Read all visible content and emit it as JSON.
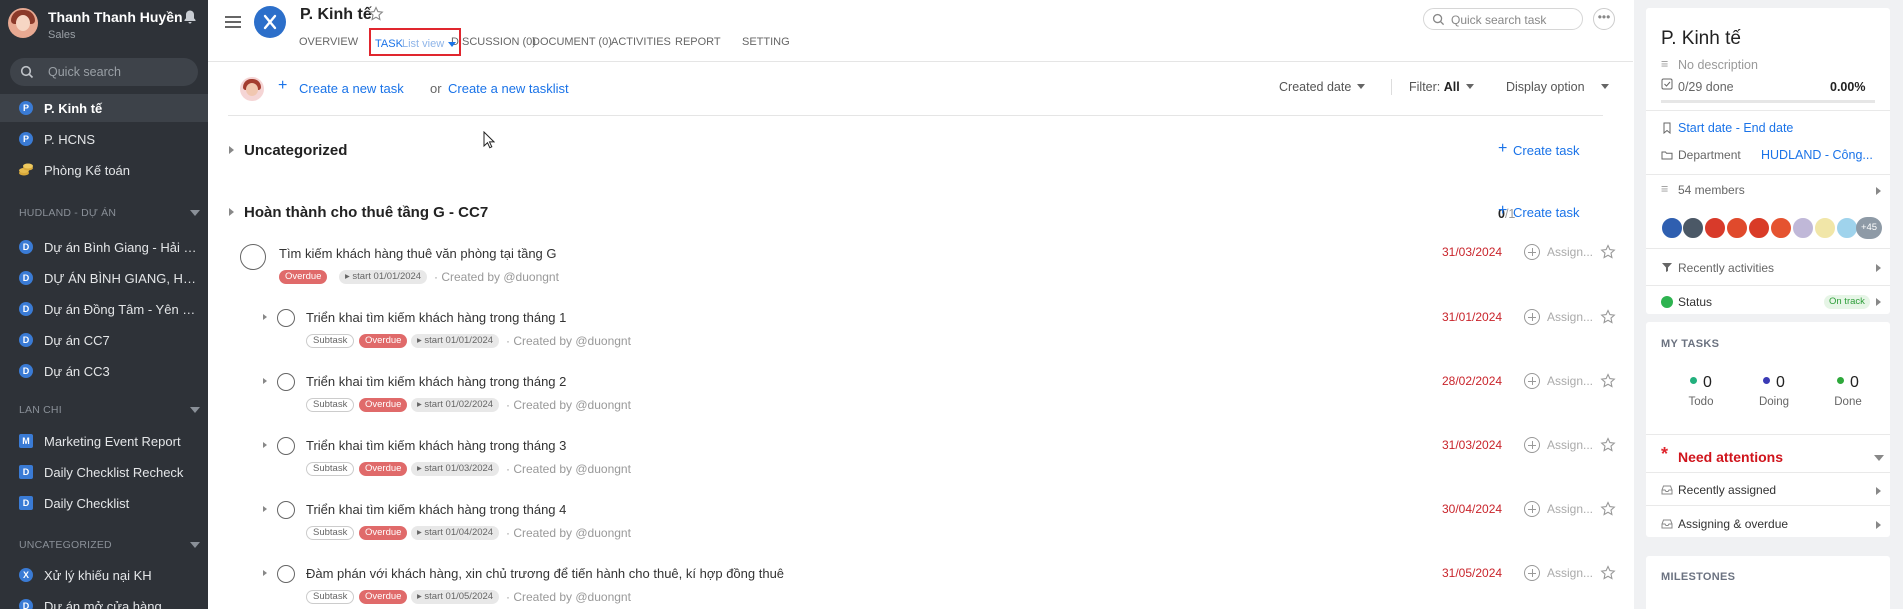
{
  "sidebar": {
    "user": {
      "name": "Thanh Thanh Huyền",
      "role": "Sales"
    },
    "search_placeholder": "Quick search",
    "items_top": [
      {
        "badge": "P",
        "label": "P. Kinh tế",
        "active": true
      },
      {
        "badge": "P",
        "label": "P. HCNS"
      },
      {
        "badge": "",
        "label": "Phòng Kế toán",
        "icon": "coins-icon"
      }
    ],
    "sections": [
      {
        "title": "HUDLAND - DỰ ÁN",
        "items": [
          {
            "badge": "D",
            "label": "Dự án Bình Giang - Hải D..."
          },
          {
            "badge": "D",
            "label": "DỰ ÁN BÌNH GIANG, HẢI ..."
          },
          {
            "badge": "D",
            "label": "Dự án Đồng Tâm - Yên Bái"
          },
          {
            "badge": "D",
            "label": "Dự án CC7"
          },
          {
            "badge": "D",
            "label": "Dự án CC3"
          }
        ]
      },
      {
        "title": "LAN CHI",
        "items": [
          {
            "badge": "M",
            "label": "Marketing Event Report"
          },
          {
            "badge": "D",
            "label": "Daily Checklist Recheck"
          },
          {
            "badge": "D",
            "label": "Daily Checklist"
          }
        ]
      },
      {
        "title": "UNCATEGORIZED",
        "items": [
          {
            "badge": "X",
            "label": "Xử lý khiếu nại KH"
          },
          {
            "badge": "D",
            "label": "Dự án mở cửa hàng"
          }
        ]
      }
    ]
  },
  "header": {
    "title": "P. Kinh tế",
    "tabs": {
      "overview": "OVERVIEW",
      "task": "TASK",
      "task_view": "List view",
      "discussion": "DISCUSSION (0)",
      "document": "DOCUMENT (0)",
      "activities": "ACTIVITIES",
      "report": "REPORT",
      "setting": "SETTING"
    },
    "search_placeholder": "Quick search task"
  },
  "toolbar": {
    "create_task": "Create a new task",
    "or": "or",
    "create_tasklist": "Create a new tasklist",
    "sort": "Created date",
    "filter_label": "Filter:",
    "filter_value": "All",
    "display": "Display option"
  },
  "groups": [
    {
      "title": "Uncategorized",
      "create": "Create task"
    },
    {
      "title": "Hoàn thành cho thuê tầng G - CC7",
      "count_done": "0",
      "count_total": "/1",
      "create": "Create task"
    }
  ],
  "tasks": [
    {
      "title": "Tìm kiếm khách hàng thuê văn phòng tại tầng G",
      "overdue": "Overdue",
      "start": "start 01/01/2024",
      "created": "· Created by @duongnt",
      "due": "31/03/2024",
      "assign": "Assign..."
    },
    {
      "title": "Triển khai tìm kiếm khách hàng trong tháng 1",
      "subtask": "Subtask",
      "overdue": "Overdue",
      "start": "start 01/01/2024",
      "created": "· Created by @duongnt",
      "due": "31/01/2024",
      "assign": "Assign..."
    },
    {
      "title": "Triển khai tìm kiếm khách hàng trong tháng 2",
      "subtask": "Subtask",
      "overdue": "Overdue",
      "start": "start 01/02/2024",
      "created": "· Created by @duongnt",
      "due": "28/02/2024",
      "assign": "Assign..."
    },
    {
      "title": "Triển khai tìm kiếm khách hàng trong tháng 3",
      "subtask": "Subtask",
      "overdue": "Overdue",
      "start": "start 01/03/2024",
      "created": "· Created by @duongnt",
      "due": "31/03/2024",
      "assign": "Assign..."
    },
    {
      "title": "Triển khai tìm kiếm khách hàng trong tháng 4",
      "subtask": "Subtask",
      "overdue": "Overdue",
      "start": "start 01/04/2024",
      "created": "· Created by @duongnt",
      "due": "30/04/2024",
      "assign": "Assign..."
    },
    {
      "title": "Đàm phán với khách hàng, xin chủ trương để tiến hành cho thuê, kí hợp đồng thuê",
      "subtask": "Subtask",
      "overdue": "Overdue",
      "start": "start 01/05/2024",
      "created": "· Created by @duongnt",
      "due": "31/05/2024",
      "assign": "Assign..."
    }
  ],
  "panel": {
    "title": "P. Kinh tế",
    "description": "No description",
    "progress_text": "0/29 done",
    "progress_pct": "0.00%",
    "start_date": "Start date",
    "dash": "-",
    "end_date": "End date",
    "department_label": "Department",
    "department_value": "HUDLAND - Công...",
    "members": "54 members",
    "members_more": "+45",
    "recent_activities": "Recently activities",
    "status_label": "Status",
    "status_value": "On track",
    "my_tasks": "MY TASKS",
    "todo": {
      "count": "0",
      "label": "Todo"
    },
    "doing": {
      "count": "0",
      "label": "Doing"
    },
    "done": {
      "count": "0",
      "label": "Done"
    },
    "need_attentions": "Need attentions",
    "recently_assigned": "Recently assigned",
    "assigning_overdue": "Assigning & overdue",
    "milestones": "MILESTONES"
  },
  "colors": {
    "accent": "#1a73e8",
    "overdue": "#e06a6a",
    "due": "#c9242b",
    "sidebar": "#2e3238",
    "highlight": "#e0262e"
  }
}
